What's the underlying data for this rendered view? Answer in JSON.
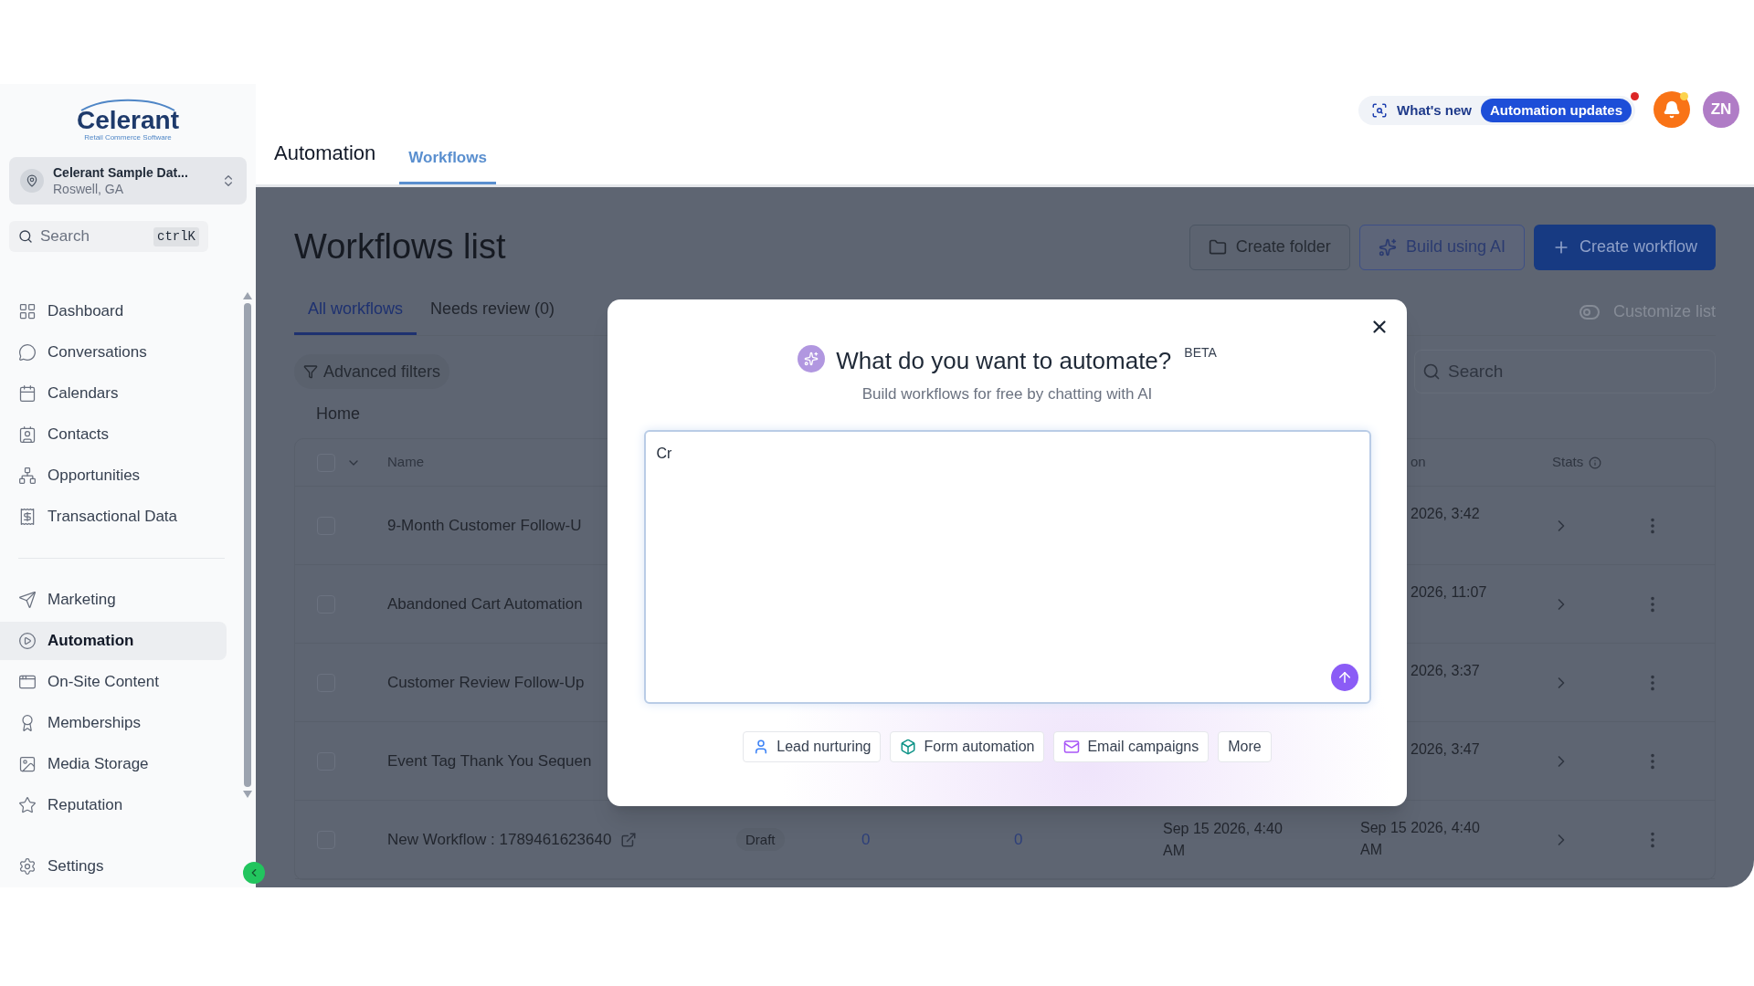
{
  "sidebar": {
    "logo": {
      "name": "Celerant",
      "tagline": "Retail Commerce Software"
    },
    "account": {
      "name": "Celerant Sample Dat...",
      "location": "Roswell, GA"
    },
    "search": {
      "placeholder": "Search",
      "shortcut": "ctrlK"
    },
    "nav_groups": [
      [
        {
          "label": "Dashboard",
          "selected": false
        },
        {
          "label": "Conversations",
          "selected": false
        },
        {
          "label": "Calendars",
          "selected": false
        },
        {
          "label": "Contacts",
          "selected": false
        },
        {
          "label": "Opportunities",
          "selected": false
        },
        {
          "label": "Transactional Data",
          "selected": false
        }
      ],
      [
        {
          "label": "Marketing",
          "selected": false
        },
        {
          "label": "Automation",
          "selected": true
        },
        {
          "label": "On-Site Content",
          "selected": false
        },
        {
          "label": "Memberships",
          "selected": false
        },
        {
          "label": "Media Storage",
          "selected": false
        },
        {
          "label": "Reputation",
          "selected": false
        }
      ]
    ],
    "footer_item": {
      "label": "Settings",
      "selected": false
    }
  },
  "header": {
    "title": "Automation",
    "tabs": [
      {
        "label": "Workflows",
        "selected": true
      }
    ],
    "whats_new": "What's new",
    "updates_badge": "Automation updates",
    "notifications_unread": true,
    "avatar": "ZN"
  },
  "page": {
    "title": "Workflows list",
    "buttons": [
      {
        "label": "Create folder",
        "kind": "outline"
      },
      {
        "label": "Build using AI",
        "kind": "ai"
      },
      {
        "label": "Create workflow",
        "kind": "primary"
      }
    ],
    "tabs": [
      {
        "label": "All workflows",
        "selected": true
      },
      {
        "label": "Needs review (0)",
        "selected": false
      }
    ],
    "customize": "Customize list",
    "filters": "Advanced filters",
    "search_placeholder": "Search",
    "breadcrumb": "Home",
    "table": {
      "select_all_checked": false,
      "name_column": "Name",
      "date_column": "on",
      "stats_column": "Stats",
      "rows": [
        {
          "kind": "partial",
          "checked": false,
          "name": "9-Month Customer Follow-U",
          "updated": "2026, 3:42"
        },
        {
          "kind": "partial",
          "checked": false,
          "name": "Abandoned Cart Automation",
          "updated": "2026, 11:07"
        },
        {
          "kind": "partial",
          "checked": false,
          "name": "Customer Review Follow-Up",
          "updated": "2026, 3:37"
        },
        {
          "kind": "partial",
          "checked": false,
          "name": "Event Tag Thank You Sequen",
          "updated": "2026, 3:47"
        },
        {
          "kind": "full",
          "checked": false,
          "name": "New Workflow : 1789461623640",
          "status": "Draft",
          "count_1": "0",
          "count_2": "0",
          "created": "Sep 15 2026, 4:40 AM",
          "updated": "Sep 15 2026, 4:40 AM"
        }
      ]
    }
  },
  "modal": {
    "title": "What do you want to automate?",
    "badge": "BETA",
    "subtitle": "Build workflows for free by chatting with AI",
    "prompt_value": "Cr",
    "suggestions": [
      {
        "label": "Lead nurturing",
        "color": "#3b82f6"
      },
      {
        "label": "Form automation",
        "color": "#0f9488"
      },
      {
        "label": "Email campaigns",
        "color": "#a855f7"
      },
      {
        "label": "More"
      }
    ]
  }
}
